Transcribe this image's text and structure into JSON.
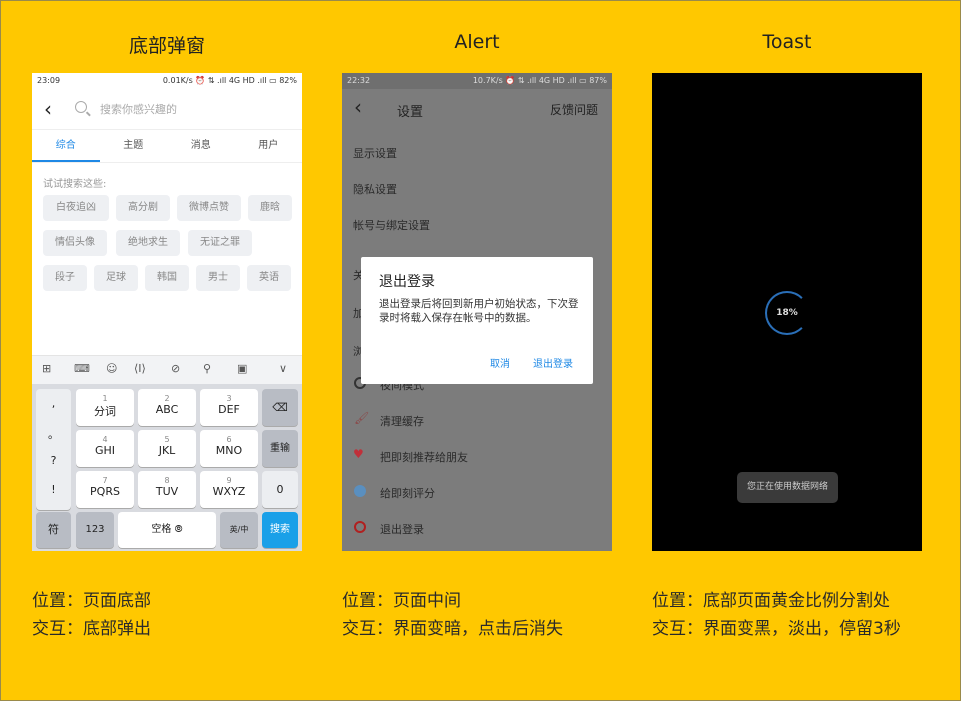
{
  "columns": [
    {
      "title": "底部弹窗",
      "caption": [
        "位置：页面底部",
        "交互：底部弹出"
      ]
    },
    {
      "title": "Alert",
      "caption": [
        "位置：页面中间",
        "交互：界面变暗，点击后消失"
      ]
    },
    {
      "title": "Toast",
      "caption": [
        "位置：底部页面黄金比例分割处",
        "交互：界面变黑，淡出，停留3秒"
      ]
    }
  ],
  "phone1": {
    "status_time": "23:09",
    "status_right": "0.01K/s ⏰ ⇅ .ıll 4G HD .ıll ▭ 82%",
    "back": "‹",
    "search_placeholder": "搜索你感兴趣的",
    "tabs": [
      "综合",
      "主题",
      "消息",
      "用户"
    ],
    "try_label": "试试搜索这些:",
    "chips": [
      "白夜追凶",
      "高分剧",
      "微博点赞",
      "鹿晗",
      "情侣头像",
      "绝地求生",
      "无证之罪",
      "段子",
      "足球",
      "韩国",
      "男士",
      "英语"
    ],
    "toolbar_icons": [
      "⊞",
      "⌨",
      "☺",
      "⟨I⟩",
      "⊘",
      "⚲",
      "▣",
      "∨"
    ],
    "keys": {
      "left": [
        ",",
        "。",
        "?",
        "!"
      ],
      "grid": [
        {
          "d": "1",
          "l": "分词"
        },
        {
          "d": "2",
          "l": "ABC"
        },
        {
          "d": "3",
          "l": "DEF"
        },
        {
          "d": "4",
          "l": "GHI"
        },
        {
          "d": "5",
          "l": "JKL"
        },
        {
          "d": "6",
          "l": "MNO"
        },
        {
          "d": "7",
          "l": "PQRS"
        },
        {
          "d": "8",
          "l": "TUV"
        },
        {
          "d": "9",
          "l": "WXYZ"
        }
      ],
      "backspace": "⌫",
      "enter": "重输",
      "zero": "0",
      "symbol": "符",
      "num": "123",
      "space": "空格 ⦾",
      "lang": "英/中",
      "search": "搜索"
    }
  },
  "phone2": {
    "status_time": "22:32",
    "status_right": "10.7K/s ⏰ ⇅ .ıll 4G HD .ıll ▭ 87%",
    "back": "‹",
    "title": "设置",
    "feedback": "反馈问题",
    "items": [
      "显示设置",
      "隐私设置",
      "帐号与绑定设置",
      "夜间模式",
      "清理缓存",
      "把即刻推荐给朋友",
      "给即刻评分",
      "退出登录"
    ],
    "peek": [
      "关",
      "加",
      "浏"
    ],
    "dialog": {
      "title": "退出登录",
      "body": "退出登录后将回到新用户初始状态，下次登录时将载入保存在帐号中的数据。",
      "cancel": "取消",
      "confirm": "退出登录"
    },
    "colors": {
      "heart": "#c0303a",
      "star": "#3a7ab5",
      "power": "#b02020",
      "moon": "#333333"
    }
  },
  "phone3": {
    "progress_text": "18%",
    "progress": 0.18,
    "toast": "您正在使用数据网络"
  }
}
